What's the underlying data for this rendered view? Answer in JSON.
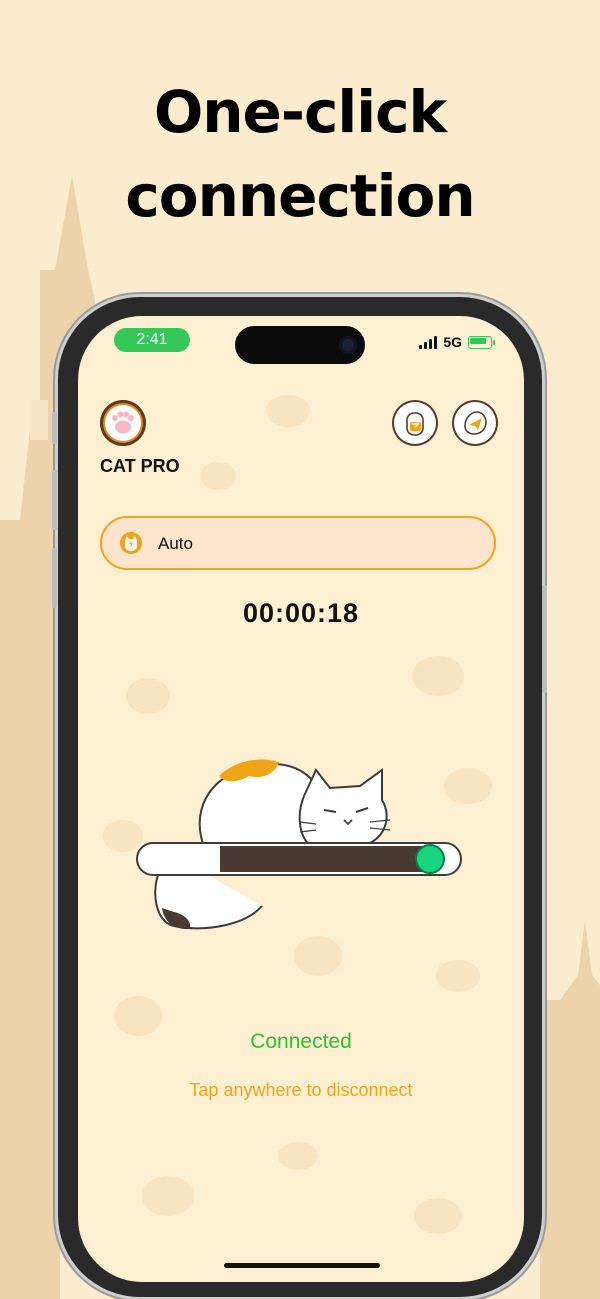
{
  "headline": {
    "line1": "One-click",
    "line2": "connection"
  },
  "status_bar": {
    "time": "2:41",
    "network": "5G"
  },
  "app": {
    "name": "CAT PRO"
  },
  "mode": {
    "label": "Auto"
  },
  "connection": {
    "timer": "00:00:18",
    "status": "Connected",
    "hint": "Tap anywhere to disconnect",
    "slider_progress": 0.95
  },
  "colors": {
    "background": "#fbeccd",
    "screen": "#fcefd2",
    "accent": "#f0a418",
    "connected": "#2fbf2f",
    "knob": "#19d67e",
    "slider_fill": "#4a3b32"
  }
}
